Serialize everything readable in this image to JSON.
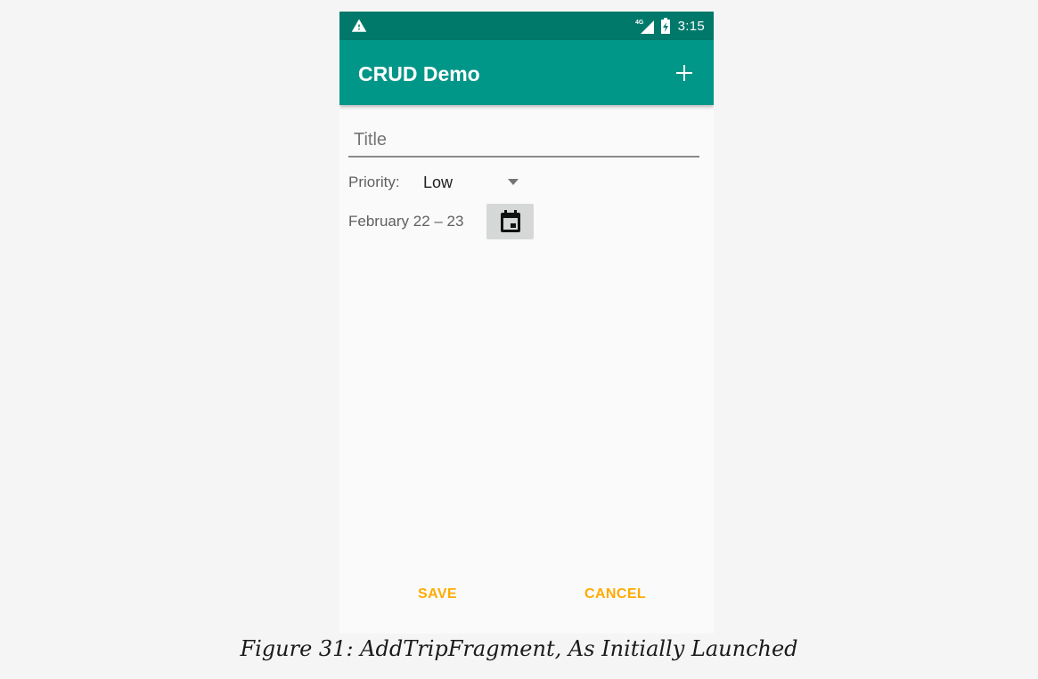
{
  "status_bar": {
    "time": "3:15",
    "network": "4G",
    "icons": [
      "warning-icon",
      "signal-icon",
      "battery-icon"
    ],
    "color": "#00796b"
  },
  "app_bar": {
    "title": "CRUD Demo",
    "add_icon": "plus-icon",
    "color": "#009688"
  },
  "form": {
    "title_placeholder": "Title",
    "title_value": "",
    "priority_label": "Priority:",
    "priority_value": "Low",
    "date_range": "February 22 – 23",
    "calendar_icon": "calendar-icon"
  },
  "actions": {
    "save_label": "SAVE",
    "cancel_label": "CANCEL",
    "accent": "#ffab00"
  },
  "caption": "Figure 31: AddTripFragment, As Initially Launched"
}
